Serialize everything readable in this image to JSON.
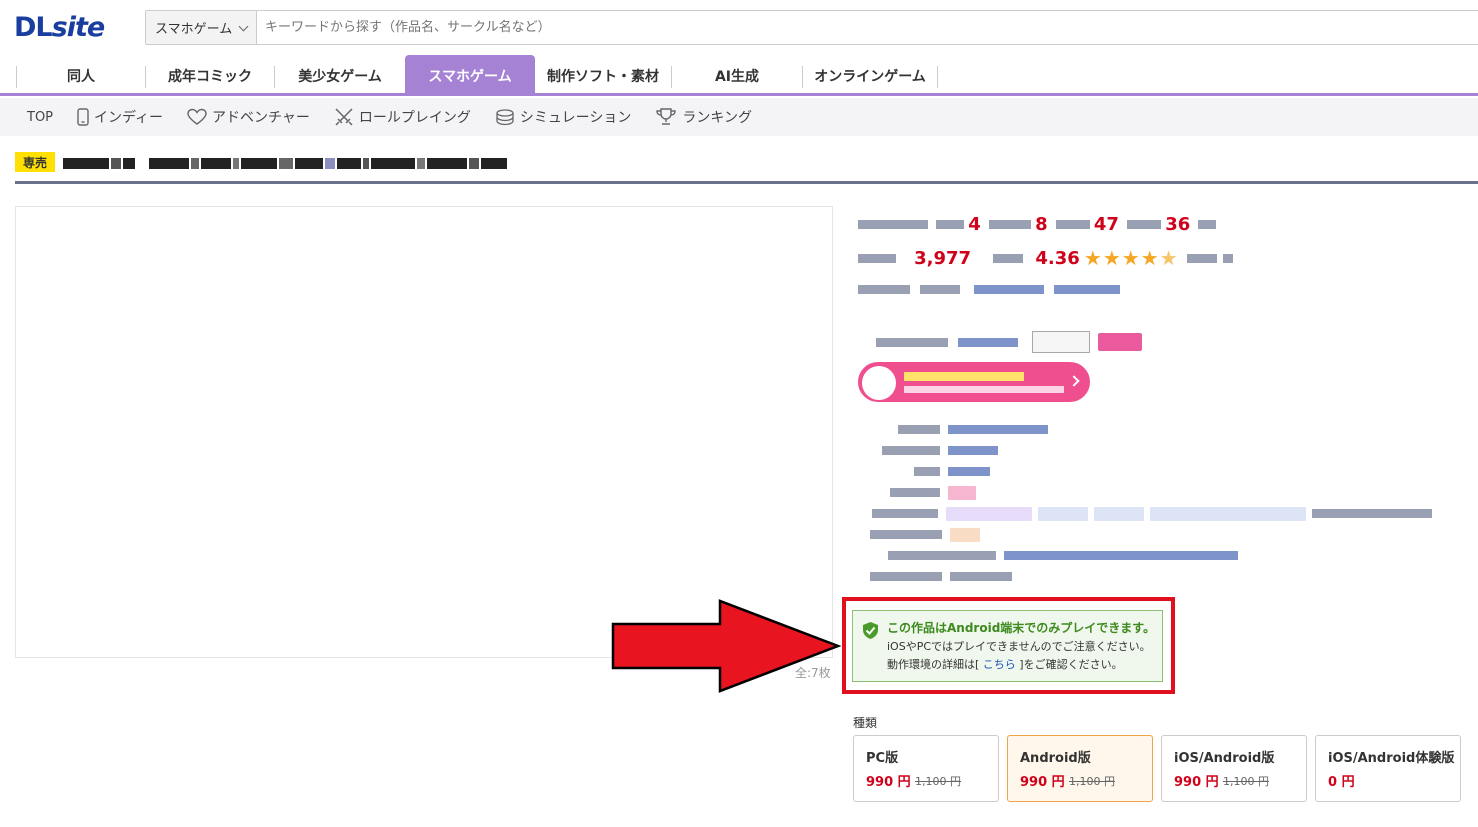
{
  "header": {
    "logo": "DLsite",
    "search": {
      "category": "スマホゲーム",
      "placeholder": "キーワードから探す（作品名、サークル名など）"
    }
  },
  "main_nav": {
    "tabs": [
      {
        "label": "同人"
      },
      {
        "label": "成年コミック"
      },
      {
        "label": "美少女ゲーム"
      },
      {
        "label": "スマホゲーム",
        "active": true
      },
      {
        "label": "制作ソフト・素材"
      },
      {
        "label": "AI生成"
      },
      {
        "label": "オンラインゲーム"
      }
    ],
    "accent_color": "#a682d4"
  },
  "sub_nav": {
    "items": [
      {
        "label": "TOP",
        "icon": "none"
      },
      {
        "label": "インディー",
        "icon": "smartphone-icon"
      },
      {
        "label": "アドベンチャー",
        "icon": "heart-icon"
      },
      {
        "label": "ロールプレイング",
        "icon": "crossed-swords-icon"
      },
      {
        "label": "シミュレーション",
        "icon": "coins-icon"
      },
      {
        "label": "ランキング",
        "icon": "trophy-icon"
      }
    ]
  },
  "product": {
    "exclusive_badge": "専売",
    "ranking": {
      "day": "4",
      "week": "8",
      "year": "47",
      "total": "36"
    },
    "sales_count": "3,977",
    "rating_value": "4.36",
    "rating_stars": 4.5,
    "image_count": "全:7枚"
  },
  "notice": {
    "line1": "この作品はAndroid端末でのみプレイできます。",
    "line2": "iOSやPCではプレイできませんのでご注意ください。",
    "line3_prefix": "動作環境の詳細は[ ",
    "line3_link": "こちら",
    "line3_suffix": " ]をご確認ください。",
    "frame_color": "#e0101e"
  },
  "types": {
    "label": "種類",
    "options": [
      {
        "name": "PC版",
        "price": "990 円",
        "original": "1,100 円"
      },
      {
        "name": "Android版",
        "price": "990 円",
        "original": "1,100 円",
        "selected": true
      },
      {
        "name": "iOS/Android版",
        "price": "990 円",
        "original": "1,100 円"
      },
      {
        "name": "iOS/Android体験版",
        "price": "0 円",
        "original": ""
      }
    ]
  }
}
